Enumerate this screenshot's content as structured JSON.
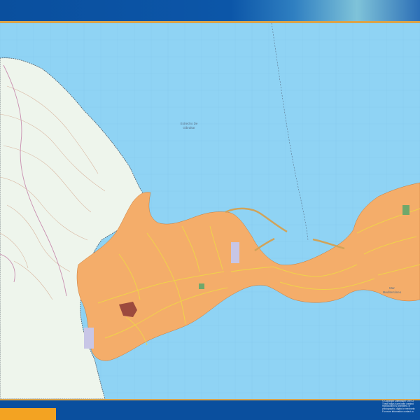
{
  "header": {
    "color_left": "#0a4f9e",
    "color_right": "#7fc3d9"
  },
  "colors": {
    "sea": "#8fd3f4",
    "land": "#eef5ec",
    "urban": "#f4ad6a",
    "road": "#f0d24a",
    "grid": "#7ec3e8",
    "frame_rule": "#d9a34a",
    "accent": "#f3a322"
  },
  "map": {
    "labels": {
      "strait_line1": "Estrecho De",
      "strait_line2": "Gibraltar",
      "sea_line1": "Mar",
      "sea_line2": "Mediterráneo"
    }
  },
  "footer": {
    "copyright": [
      "© Copyright Citiesmap® 1997-2",
      "These maps have been created",
      "reproduction is prohibited, in",
      "photographic, digital or mechanic",
      "For more information contact: w"
    ]
  }
}
